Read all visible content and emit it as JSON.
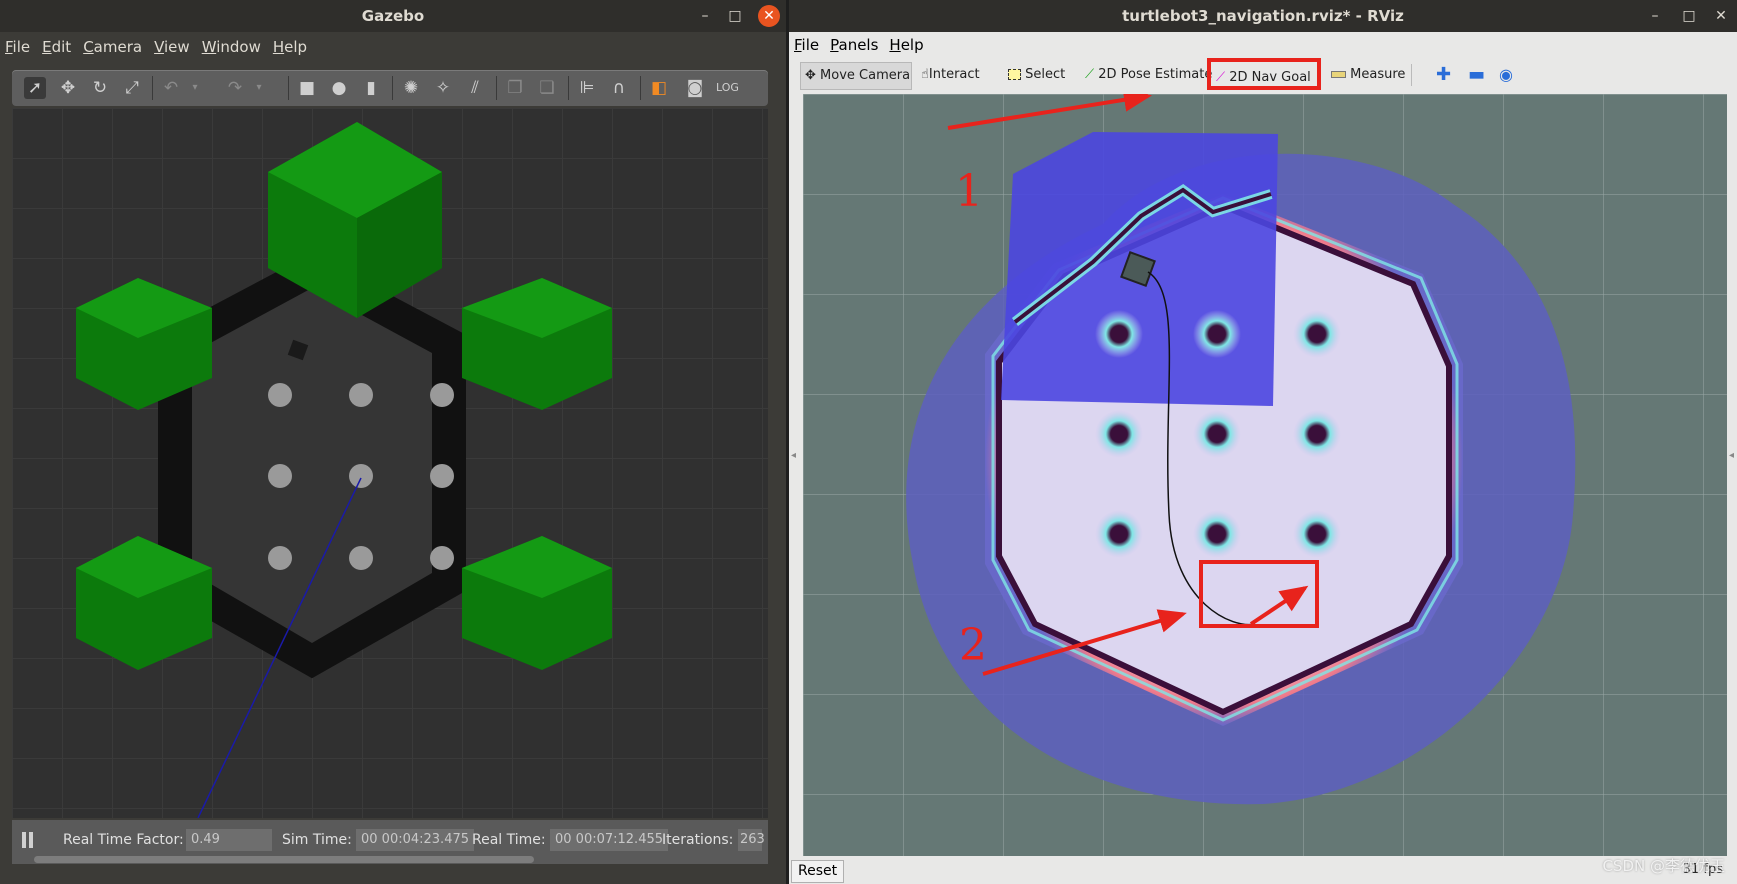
{
  "gazebo": {
    "title": "Gazebo",
    "menu": [
      "File",
      "Edit",
      "Camera",
      "View",
      "Window",
      "Help"
    ],
    "tools": [
      "select-arrow-icon",
      "translate-icon",
      "rotate-icon",
      "scale-icon",
      "undo-icon",
      "redo-icon",
      "box-icon",
      "sphere-icon",
      "cylinder-icon",
      "point-light-icon",
      "spot-light-icon",
      "directional-light-icon",
      "copy-icon",
      "paste-icon",
      "align-icon",
      "snap-icon",
      "view-angle-icon",
      "screenshot-icon",
      "log-icon"
    ],
    "status": {
      "rtf_label": "Real Time Factor:",
      "rtf_value": "0.49",
      "sim_label": "Sim Time:",
      "sim_value": "00 00:04:23.475",
      "real_label": "Real Time:",
      "real_value": "00 00:07:12.455",
      "iter_label": "Iterations:",
      "iter_value": "263"
    },
    "colors": {
      "green": "#0a8a0a",
      "wall": "#111111",
      "floor": "#303030"
    }
  },
  "rviz": {
    "title": "turtlebot3_navigation.rviz* - RViz",
    "menu": [
      "File",
      "Panels",
      "Help"
    ],
    "toolbar": {
      "move_camera": "Move Camera",
      "interact": "Interact",
      "select": "Select",
      "pose_estimate": "2D Pose Estimate",
      "nav_goal": "2D Nav Goal",
      "measure": "Measure"
    },
    "bottom": {
      "reset": "Reset",
      "fps": "31 fps"
    },
    "annotations": {
      "one": "1",
      "two": "2"
    },
    "colors": {
      "highlight": "#e8231c",
      "costmap_blue": "#4b46e0",
      "inflation": "#c8c3ee"
    }
  },
  "watermark": "CSDN @李德优玉"
}
